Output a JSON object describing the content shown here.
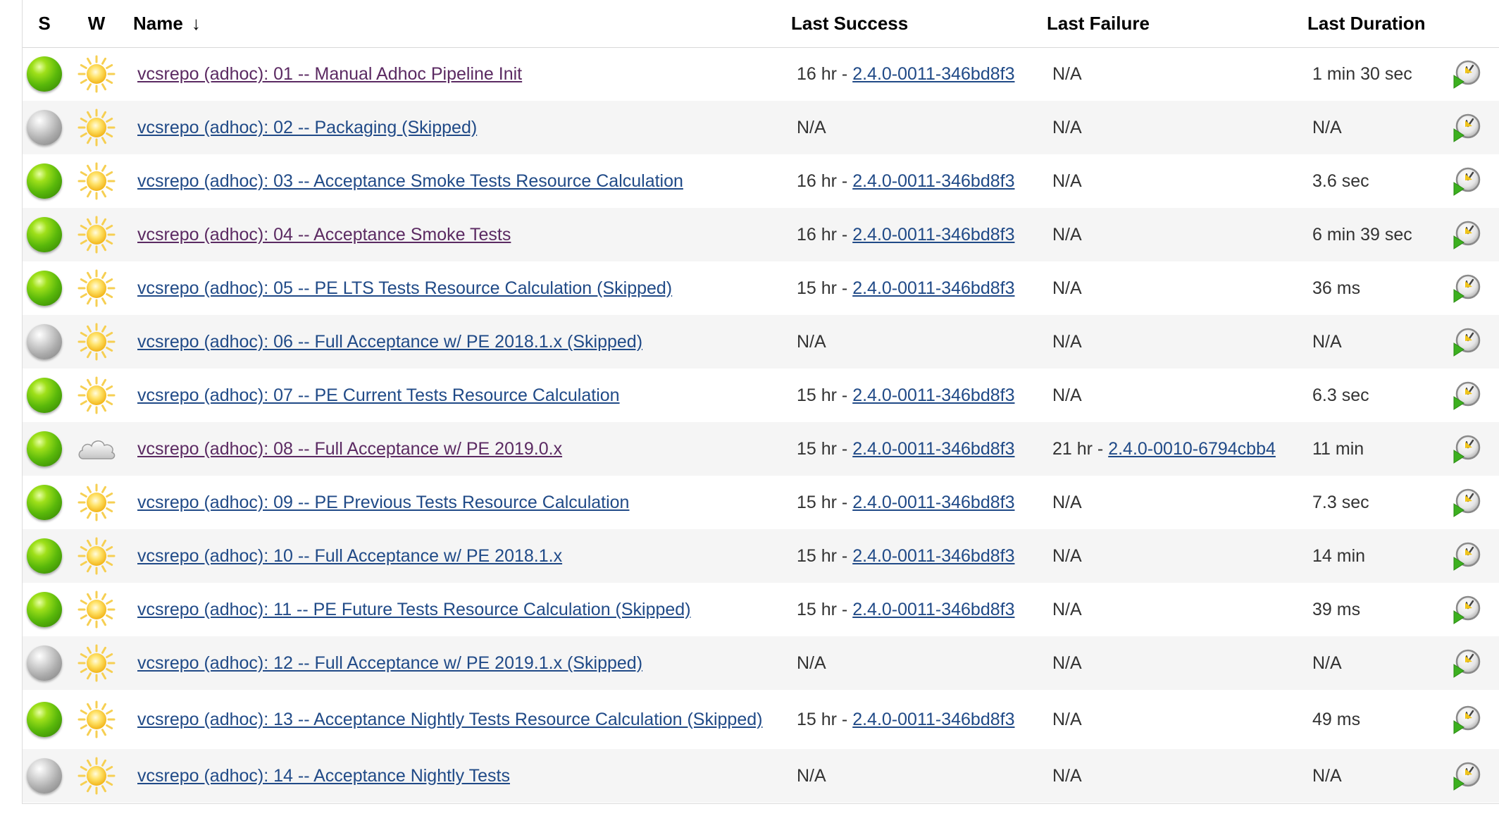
{
  "header": {
    "s": "S",
    "w": "W",
    "name": "Name",
    "sort_arrow": "↓",
    "last_success": "Last Success",
    "last_failure": "Last Failure",
    "last_duration": "Last Duration"
  },
  "colors": {
    "link_visited": "#5b2a62",
    "link_unvisited": "#204a87",
    "status_success": "#59b80a",
    "status_not_built": "#aaaaaa",
    "row_alt": "#f5f5f5"
  },
  "rows": [
    {
      "status": "success",
      "weather": "sunny",
      "name": "vcsrepo (adhoc): 01 -- Manual Adhoc Pipeline Init",
      "visited": true,
      "last_success": {
        "age": "16 hr - ",
        "build": "2.4.0-0011-346bd8f3"
      },
      "last_failure": {
        "text": "N/A"
      },
      "duration": "1 min 30 sec"
    },
    {
      "status": "not-built",
      "weather": "sunny",
      "name": "vcsrepo (adhoc): 02 -- Packaging (Skipped)",
      "visited": false,
      "last_success": {
        "text": "N/A"
      },
      "last_failure": {
        "text": "N/A"
      },
      "duration": "N/A"
    },
    {
      "status": "success",
      "weather": "sunny",
      "name": "vcsrepo (adhoc): 03 -- Acceptance Smoke Tests Resource Calculation",
      "visited": false,
      "last_success": {
        "age": "16 hr - ",
        "build": "2.4.0-0011-346bd8f3"
      },
      "last_failure": {
        "text": "N/A"
      },
      "duration": "3.6 sec"
    },
    {
      "status": "success",
      "weather": "sunny",
      "name": "vcsrepo (adhoc): 04 -- Acceptance Smoke Tests",
      "visited": true,
      "last_success": {
        "age": "16 hr - ",
        "build": "2.4.0-0011-346bd8f3"
      },
      "last_failure": {
        "text": "N/A"
      },
      "duration": "6 min 39 sec"
    },
    {
      "status": "success",
      "weather": "sunny",
      "name": "vcsrepo (adhoc): 05 -- PE LTS Tests Resource Calculation (Skipped)",
      "visited": false,
      "last_success": {
        "age": "15 hr - ",
        "build": "2.4.0-0011-346bd8f3"
      },
      "last_failure": {
        "text": "N/A"
      },
      "duration": "36 ms"
    },
    {
      "status": "not-built",
      "weather": "sunny",
      "name": "vcsrepo (adhoc): 06 -- Full Acceptance w/ PE 2018.1.x (Skipped)",
      "visited": false,
      "last_success": {
        "text": "N/A"
      },
      "last_failure": {
        "text": "N/A"
      },
      "duration": "N/A"
    },
    {
      "status": "success",
      "weather": "sunny",
      "name": "vcsrepo (adhoc): 07 -- PE Current Tests Resource Calculation",
      "visited": false,
      "last_success": {
        "age": "15 hr - ",
        "build": "2.4.0-0011-346bd8f3"
      },
      "last_failure": {
        "text": "N/A"
      },
      "duration": "6.3 sec"
    },
    {
      "status": "success",
      "weather": "cloudy",
      "name": "vcsrepo (adhoc): 08 -- Full Acceptance w/ PE 2019.0.x",
      "visited": true,
      "last_success": {
        "age": "15 hr - ",
        "build": "2.4.0-0011-346bd8f3"
      },
      "last_failure": {
        "age": "21 hr - ",
        "build": "2.4.0-0010-6794cbb4"
      },
      "duration": "11 min"
    },
    {
      "status": "success",
      "weather": "sunny",
      "name": "vcsrepo (adhoc): 09 -- PE Previous Tests Resource Calculation",
      "visited": false,
      "last_success": {
        "age": "15 hr - ",
        "build": "2.4.0-0011-346bd8f3"
      },
      "last_failure": {
        "text": "N/A"
      },
      "duration": "7.3 sec"
    },
    {
      "status": "success",
      "weather": "sunny",
      "name": "vcsrepo (adhoc): 10 -- Full Acceptance w/ PE 2018.1.x",
      "visited": false,
      "last_success": {
        "age": "15 hr - ",
        "build": "2.4.0-0011-346bd8f3"
      },
      "last_failure": {
        "text": "N/A"
      },
      "duration": "14 min"
    },
    {
      "status": "success",
      "weather": "sunny",
      "name": "vcsrepo (adhoc): 11 -- PE Future Tests Resource Calculation (Skipped)",
      "visited": false,
      "last_success": {
        "age": "15 hr - ",
        "build": "2.4.0-0011-346bd8f3"
      },
      "last_failure": {
        "text": "N/A"
      },
      "duration": "39 ms"
    },
    {
      "status": "not-built",
      "weather": "sunny",
      "name": "vcsrepo (adhoc): 12 -- Full Acceptance w/ PE 2019.1.x (Skipped)",
      "visited": false,
      "last_success": {
        "text": "N/A"
      },
      "last_failure": {
        "text": "N/A"
      },
      "duration": "N/A"
    },
    {
      "status": "success",
      "weather": "sunny",
      "name": "vcsrepo (adhoc): 13 -- Acceptance Nightly Tests Resource Calculation (Skipped)",
      "visited": false,
      "last_success": {
        "age": "15 hr - ",
        "build": "2.4.0-0011-346bd8f3"
      },
      "last_failure": {
        "text": "N/A"
      },
      "duration": "49 ms"
    },
    {
      "status": "not-built",
      "weather": "sunny",
      "name": "vcsrepo (adhoc): 14 -- Acceptance Nightly Tests",
      "visited": false,
      "last_success": {
        "text": "N/A"
      },
      "last_failure": {
        "text": "N/A"
      },
      "duration": "N/A"
    }
  ]
}
